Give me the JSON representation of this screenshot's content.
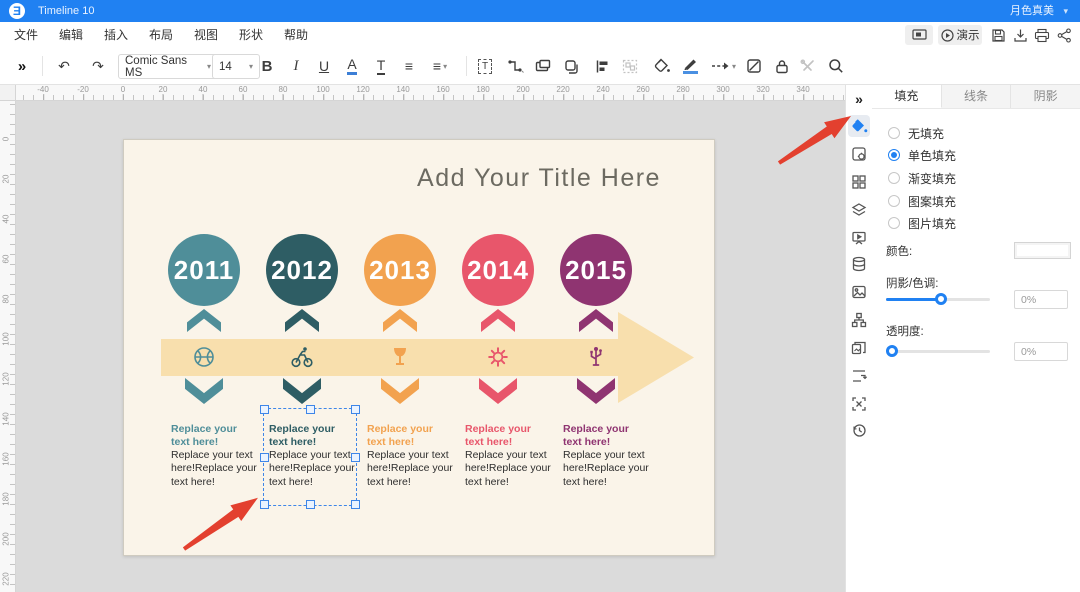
{
  "titlebar": {
    "app_title": "Timeline 10",
    "account": "月色真美"
  },
  "menubar": {
    "items": [
      "文件",
      "编辑",
      "插入",
      "布局",
      "视图",
      "形状",
      "帮助"
    ],
    "present_label": "演示"
  },
  "toolbar": {
    "font_name": "Comic Sans MS",
    "font_size": "14",
    "icons": [
      "collapse-icon",
      "undo-icon",
      "redo-icon",
      "bold-icon",
      "italic-icon",
      "underline-icon",
      "font-color-icon",
      "text-style-icon",
      "line-spacing-icon",
      "list-icon",
      "text-box-icon",
      "connector-icon",
      "shape-icon",
      "copy-style-icon",
      "align-icon",
      "group-icon",
      "fill-bucket-icon",
      "pen-color-icon",
      "line-style-icon",
      "no-style-icon",
      "lock-icon",
      "tools-icon",
      "search-icon"
    ]
  },
  "rulers": {
    "top_labels": [
      "-40",
      "-20",
      "0",
      "20",
      "40",
      "60",
      "80",
      "100",
      "120",
      "140",
      "160",
      "180",
      "200",
      "220",
      "240",
      "260",
      "280",
      "300",
      "320",
      "340"
    ],
    "left_labels": [
      "0",
      "20",
      "40",
      "60",
      "80",
      "100",
      "120",
      "140",
      "160",
      "180",
      "200",
      "220"
    ]
  },
  "canvas": {
    "title": "Add Your Title Here",
    "heading": "Replace your text here!",
    "body": "Replace your text here!Replace your text here!",
    "arrow_band_color": "#F8DFAD",
    "columns": [
      {
        "year": "2011",
        "color": "#4F8E99",
        "icon": "basketball-icon"
      },
      {
        "year": "2012",
        "color": "#2E5D64",
        "icon": "cyclist-icon"
      },
      {
        "year": "2013",
        "color": "#F2A24F",
        "icon": "cocktail-icon"
      },
      {
        "year": "2014",
        "color": "#E8566B",
        "icon": "gear-icon"
      },
      {
        "year": "2015",
        "color": "#8F3471",
        "icon": "usb-icon"
      }
    ]
  },
  "panel": {
    "tabs": [
      "填充",
      "线条",
      "阴影"
    ],
    "active_tab": 0,
    "fill_options": [
      {
        "label": "无填充",
        "selected": false
      },
      {
        "label": "单色填充",
        "selected": true
      },
      {
        "label": "渐变填充",
        "selected": false
      },
      {
        "label": "图案填充",
        "selected": false
      },
      {
        "label": "图片填充",
        "selected": false
      }
    ],
    "color_label": "颜色:",
    "shadow_label": "阴影/色调:",
    "shadow_value": "0%",
    "opacity_label": "透明度:",
    "opacity_value": "0%",
    "accent_color": "#2081F2"
  }
}
